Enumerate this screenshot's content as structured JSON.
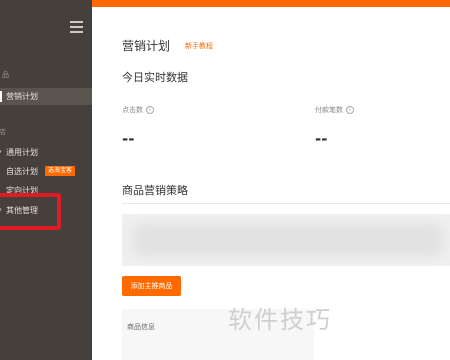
{
  "sidebar": {
    "section1_label": "品",
    "section2_label": "店",
    "items": [
      {
        "label": "营销计划",
        "active": true
      },
      {
        "label": "通用计划",
        "expanded": true
      },
      {
        "label": "自选计划",
        "badge": "选海宝客"
      },
      {
        "label": "定向计划"
      },
      {
        "label": "其他管理"
      }
    ]
  },
  "main": {
    "title": "营销计划",
    "help_link": "新手教程",
    "realtime_title": "今日实时数据",
    "stats": [
      {
        "label": "点击数",
        "value": "--"
      },
      {
        "label": "付款笔数",
        "value": "--"
      }
    ],
    "strategy_title": "商品营销策略",
    "add_button": "添加主推商品",
    "info_label": "商品信息"
  },
  "watermark": "软件技巧",
  "colors": {
    "accent": "#ff6a00",
    "sidebar_bg": "#45403b",
    "highlight": "#e01b24"
  },
  "icons": {
    "menu": "menu-icon",
    "info": "info-icon",
    "chevron": "chevron-down-icon"
  }
}
